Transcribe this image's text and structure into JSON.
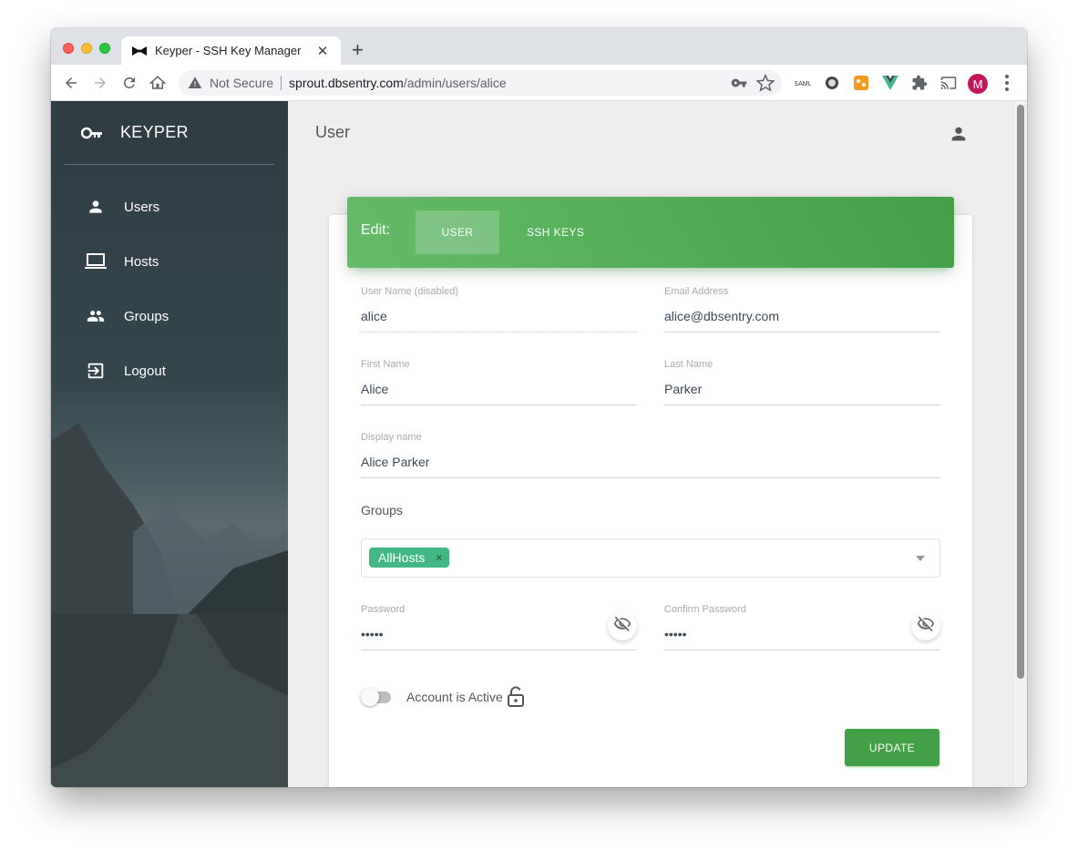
{
  "browser": {
    "tab_title": "Keyper - SSH Key Manager",
    "address": {
      "security_label": "Not Secure",
      "url_host": "sprout.dbsentry.com",
      "url_path": "/admin/users/alice"
    },
    "profile_initial": "M"
  },
  "sidebar": {
    "brand": "KEYPER",
    "items": [
      {
        "label": "Users",
        "icon": "person-icon"
      },
      {
        "label": "Hosts",
        "icon": "laptop-icon"
      },
      {
        "label": "Groups",
        "icon": "group-icon"
      },
      {
        "label": "Logout",
        "icon": "logout-icon"
      }
    ]
  },
  "header": {
    "page_title": "User"
  },
  "editor": {
    "edit_label": "Edit:",
    "tabs": [
      {
        "label": "USER",
        "active": true
      },
      {
        "label": "SSH KEYS",
        "active": false
      }
    ],
    "fields": {
      "username": {
        "label": "User Name (disabled)",
        "value": "alice"
      },
      "email": {
        "label": "Email Address",
        "value": "alice@dbsentry.com"
      },
      "first_name": {
        "label": "First Name",
        "value": "Alice"
      },
      "last_name": {
        "label": "Last Name",
        "value": "Parker"
      },
      "display_name": {
        "label": "Display name",
        "value": "Alice Parker"
      },
      "password": {
        "label": "Password",
        "value": "•••••"
      },
      "confirm_password": {
        "label": "Confirm Password",
        "value": "•••••"
      }
    },
    "groups": {
      "label": "Groups",
      "selected": [
        "AllHosts"
      ],
      "remove_glyph": "×"
    },
    "account_active": {
      "label": "Account is Active",
      "checked": false
    },
    "update_label": "UPDATE"
  },
  "colors": {
    "header_green": "#43a047",
    "chip_green": "#41b883",
    "sidebar_dark": "#2f3d43"
  }
}
